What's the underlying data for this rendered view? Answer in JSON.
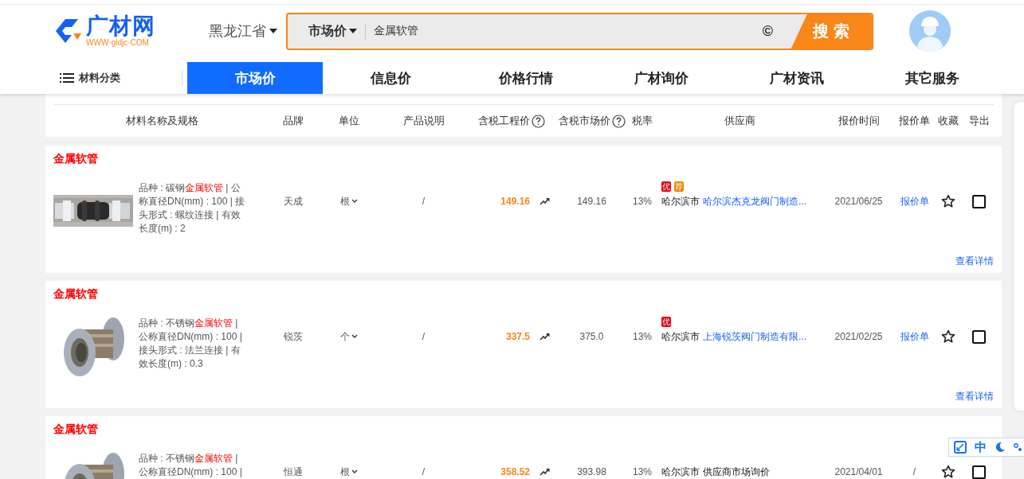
{
  "logo": {
    "name": "广材网",
    "url": "WWW·gldjc·COM"
  },
  "province": "黑龙江省",
  "search": {
    "type": "市场价",
    "value": "金属软管",
    "glyph": "©",
    "button": "搜索"
  },
  "nav": {
    "category": "材料分类",
    "tabs": [
      {
        "label": "市场价",
        "selected": true
      },
      {
        "label": "信息价",
        "selected": false
      },
      {
        "label": "价格行情",
        "selected": false
      },
      {
        "label": "广材询价",
        "selected": false
      },
      {
        "label": "广材资讯",
        "selected": false
      },
      {
        "label": "其它服务",
        "selected": false
      }
    ]
  },
  "table": {
    "columns": [
      {
        "label": "材料名称及规格",
        "help": false
      },
      {
        "label": "品牌",
        "help": false
      },
      {
        "label": "单位",
        "help": false
      },
      {
        "label": "产品说明",
        "help": false
      },
      {
        "label": "含税工程价",
        "help": true
      },
      {
        "label": "含税市场价",
        "help": true
      },
      {
        "label": "税率",
        "help": false
      },
      {
        "label": "供应商",
        "help": false
      },
      {
        "label": "报价时间",
        "help": false
      },
      {
        "label": "报价单",
        "help": false
      },
      {
        "label": "收藏",
        "help": false
      },
      {
        "label": "导出",
        "help": false
      }
    ],
    "rows": [
      {
        "title": "金属软管",
        "description": "品种 : 碳钢**金属软管** | 公称直径DN(mm) : 100 | 接头形式 : 螺纹连接 | 有效长度(m) : 2",
        "brand": "天成",
        "unit": "根",
        "note": "/",
        "engineering_price": "149.16",
        "market_price": "149.16",
        "tax": "13%",
        "badges": [
          {
            "text": "优",
            "color": "#e60012"
          },
          {
            "text": "荐",
            "color": "#f08300"
          }
        ],
        "city": "哈尔滨市",
        "supplier": "哈尔滨杰克龙阀门制造...",
        "supplier_linked": true,
        "date": "2021/06/25",
        "quote": "报价单",
        "quote_linked": true,
        "favorited": false,
        "checked": false,
        "details": "查看详情"
      },
      {
        "title": "金属软管",
        "description": "品种 : 不锈钢**金属软管** | 公称直径DN(mm) : 100 | 接头形式 : 法兰连接 | 有效长度(m) : 0.3",
        "brand": "锐茨",
        "unit": "个",
        "note": "/",
        "engineering_price": "337.5",
        "market_price": "375.0",
        "tax": "13%",
        "badges": [
          {
            "text": "优",
            "color": "#e60012"
          }
        ],
        "city": "哈尔滨市",
        "supplier": "上海锐茨阀门制造有限...",
        "supplier_linked": true,
        "date": "2021/02/25",
        "quote": "报价单",
        "quote_linked": true,
        "favorited": false,
        "checked": false,
        "details": "查看详情"
      },
      {
        "title": "金属软管",
        "description": "品种 : 不锈钢**金属软管** | 公称直径DN(mm) : 100 |",
        "brand": "恒通",
        "unit": "根",
        "note": "/",
        "engineering_price": "358.52",
        "market_price": "393.98",
        "tax": "13%",
        "badges": [],
        "city": "哈尔滨市",
        "supplier": "供应商市场询价",
        "supplier_linked": false,
        "date": "2021/04/01",
        "quote": "/",
        "quote_linked": false,
        "favorited": false,
        "checked": false
      }
    ]
  },
  "ime_toolbar": {
    "mode": "中"
  }
}
